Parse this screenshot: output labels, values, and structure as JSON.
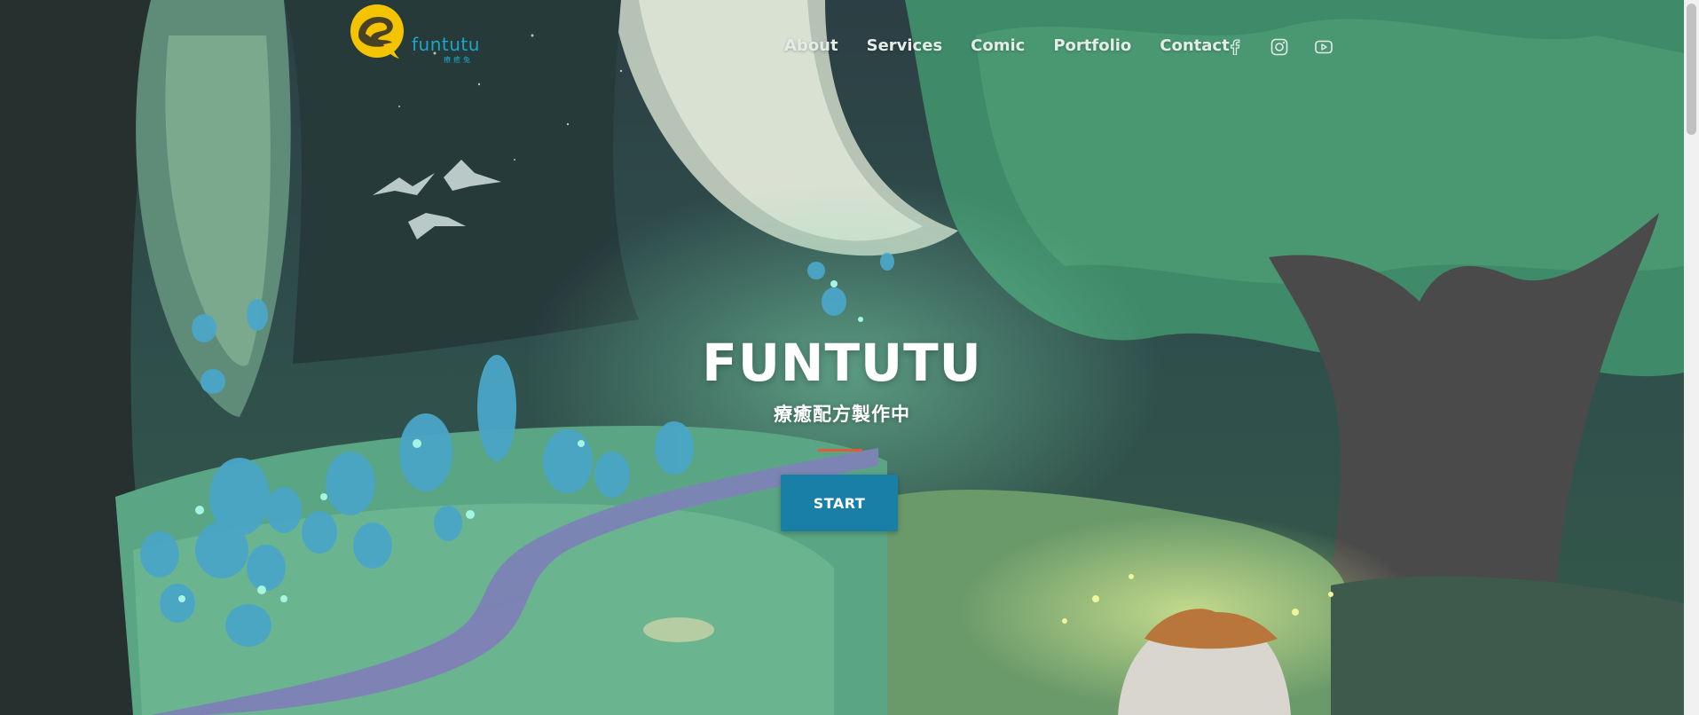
{
  "brand": {
    "logo_word": "funtutu",
    "logo_sub": "療癒兔",
    "colors": {
      "logo_yellow": "#f5c400",
      "logo_blue": "#1ea5c9"
    }
  },
  "nav": {
    "items": [
      {
        "label": "About"
      },
      {
        "label": "Services"
      },
      {
        "label": "Comic"
      },
      {
        "label": "Portfolio"
      },
      {
        "label": "Contact"
      }
    ],
    "social": [
      {
        "icon": "facebook-icon"
      },
      {
        "icon": "instagram-icon"
      },
      {
        "icon": "youtube-icon"
      }
    ]
  },
  "hero": {
    "title": "FUNTUTU",
    "subtitle": "療癒配方製作中",
    "button_label": "START",
    "colors": {
      "button": "#1a7fa6",
      "divider": "#e25a3a"
    }
  }
}
